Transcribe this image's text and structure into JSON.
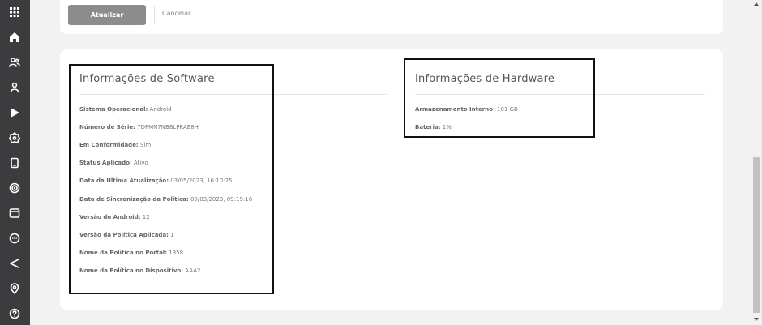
{
  "actions": {
    "primary_label": "Atualizar",
    "secondary_label": "Cancelar"
  },
  "nav_icons": [
    "apps-grid-icon",
    "home-icon",
    "users-icon",
    "user-icon",
    "play-icon",
    "settings-badge-icon",
    "device-icon",
    "target-icon",
    "window-icon",
    "chat-icon",
    "share-icon",
    "location-icon",
    "help-icon"
  ],
  "software": {
    "title": "Informações de Software",
    "items": [
      {
        "label": "Sistema Operacional:",
        "value": "Android"
      },
      {
        "label": "Número de Série:",
        "value": "7DFMN7NB8LPRAE8H"
      },
      {
        "label": "Em Conformidade:",
        "value": "Sim"
      },
      {
        "label": "Status Aplicado:",
        "value": "Ativo"
      },
      {
        "label": "Data da Última Atualização:",
        "value": "03/05/2023, 16:10:25"
      },
      {
        "label": "Data de Sincronização da Política:",
        "value": "09/03/2023, 09:19:16"
      },
      {
        "label": "Versão do Android:",
        "value": "12"
      },
      {
        "label": "Versão da Política Aplicada:",
        "value": "1"
      },
      {
        "label": "Nome da Política no Portal:",
        "value": "1358"
      },
      {
        "label": "Nome da Política no Dispositivo:",
        "value": "AAA2"
      }
    ]
  },
  "hardware": {
    "title": "Informações de Hardware",
    "items": [
      {
        "label": "Armazenamento Interno:",
        "value": "101 GB"
      },
      {
        "label": "Bateria:",
        "value": "1%"
      }
    ]
  }
}
